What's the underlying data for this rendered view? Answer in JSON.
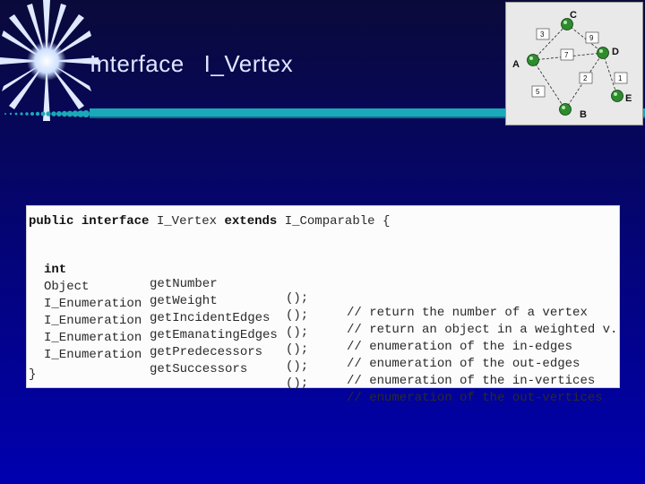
{
  "slide": {
    "title_word": "Interface",
    "title_name": "I_Vertex"
  },
  "graph": {
    "nodes": [
      {
        "id": "A",
        "label": "A"
      },
      {
        "id": "B",
        "label": "B"
      },
      {
        "id": "C",
        "label": "C"
      },
      {
        "id": "D",
        "label": "D"
      },
      {
        "id": "E",
        "label": "E"
      }
    ],
    "edge_weights": [
      "3",
      "9",
      "7",
      "2",
      "1",
      "5"
    ],
    "node_color": "#2e8b2e"
  },
  "code": {
    "header": {
      "kw1": "public",
      "kw2": "interface",
      "name": "I_Vertex",
      "kw3": "extends",
      "parent": "I_Comparable",
      "brace": "{"
    },
    "methods": [
      {
        "type": "int",
        "type_bold": true,
        "name": "getNumber",
        "sig": "();",
        "comment": "// return the number of a vertex"
      },
      {
        "type": "Object",
        "type_bold": false,
        "name": "getWeight",
        "sig": "();",
        "comment": "// return an object in a weighted v."
      },
      {
        "type": "I_Enumeration",
        "type_bold": false,
        "name": "getIncidentEdges",
        "sig": "();",
        "comment": "// enumeration of the in-edges"
      },
      {
        "type": "I_Enumeration",
        "type_bold": false,
        "name": "getEmanatingEdges",
        "sig": "();",
        "comment": "// enumeration of the out-edges"
      },
      {
        "type": "I_Enumeration",
        "type_bold": false,
        "name": "getPredecessors",
        "sig": "();",
        "comment": "// enumeration of the in-vertices"
      },
      {
        "type": "I_Enumeration",
        "type_bold": false,
        "name": "getSuccessors",
        "sig": "();",
        "comment": "// enumeration of the out-vertices"
      }
    ],
    "closing": "}"
  }
}
